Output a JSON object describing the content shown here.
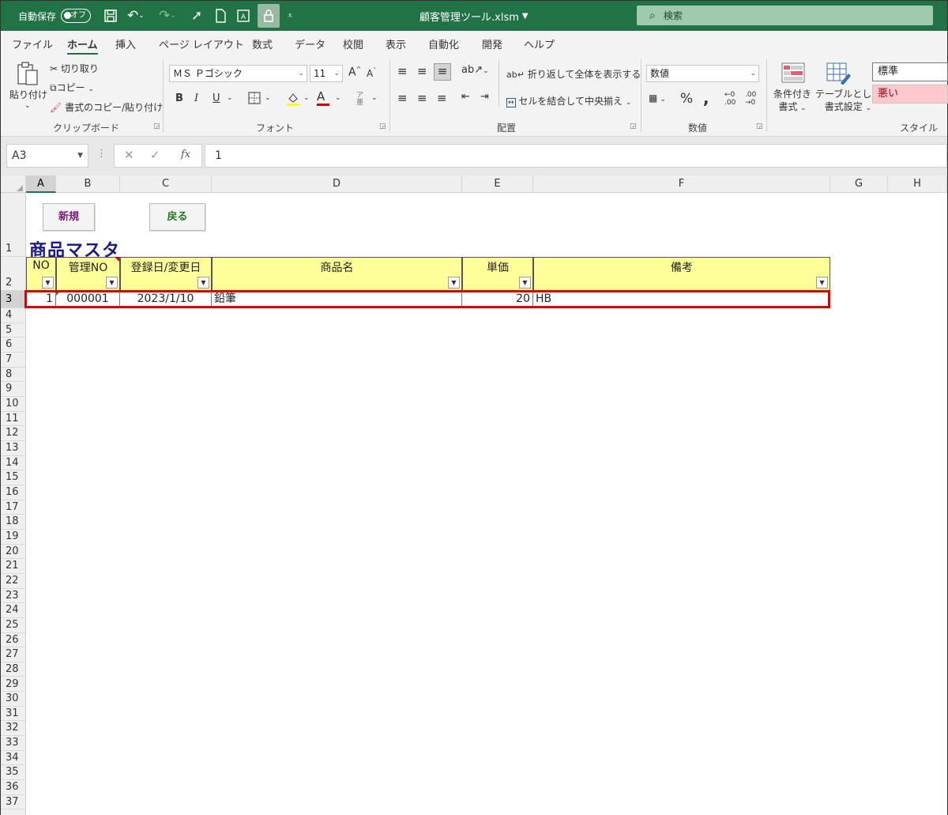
{
  "titlebar": {
    "autosave_label": "自動保存",
    "autosave_state": "オフ",
    "filename": "顧客管理ツール.xlsm",
    "search_placeholder": "検索"
  },
  "menu": {
    "tabs": [
      "ファイル",
      "ホーム",
      "挿入",
      "ページ レイアウト",
      "数式",
      "データ",
      "校閲",
      "表示",
      "自動化",
      "開発",
      "ヘルプ"
    ],
    "active_tab": "ホーム"
  },
  "ribbon": {
    "clipboard": {
      "paste": "貼り付け",
      "cut": "切り取り",
      "copy": "コピー",
      "format_painter": "書式のコピー/貼り付け",
      "group_label": "クリップボード"
    },
    "font": {
      "font_name": "ＭＳ Ｐゴシック",
      "font_size": "11",
      "bold": "B",
      "italic": "I",
      "underline": "U",
      "font_color_glyph": "A",
      "group_label": "フォント"
    },
    "alignment": {
      "wrap_text": "折り返して全体を表示する",
      "merge_center": "セルを結合して中央揃え",
      "group_label": "配置"
    },
    "number": {
      "format": "数値",
      "percent": "%",
      "comma": ",",
      "group_label": "数値"
    },
    "styles": {
      "conditional": "条件付き\n書式",
      "conditional_line1": "条件付き",
      "conditional_line2": "書式",
      "table_line1": "テーブルとして",
      "table_line2": "書式設定",
      "style_normal": "標準",
      "style_bad": "悪い",
      "group_label": "スタイル"
    }
  },
  "formula_bar": {
    "name_box": "A3",
    "formula": "1"
  },
  "columns": [
    "A",
    "B",
    "C",
    "D",
    "E",
    "F",
    "G",
    "H"
  ],
  "rows": [
    "1",
    "2",
    "3",
    "4",
    "5",
    "6",
    "7",
    "8",
    "9",
    "10",
    "11",
    "12",
    "13",
    "14",
    "15",
    "16",
    "17",
    "18",
    "19",
    "20",
    "21",
    "22",
    "23",
    "24",
    "25",
    "26",
    "27",
    "28",
    "29",
    "30",
    "31",
    "32",
    "33",
    "34",
    "35",
    "36",
    "37"
  ],
  "sheet": {
    "new_button": "新規",
    "back_button": "戻る",
    "title": "商品マスタ",
    "headers": [
      "NO",
      "管理NO",
      "登録日/変更日",
      "商品名",
      "単価",
      "備考"
    ],
    "record": {
      "no": "1",
      "mgmt_no": "000001",
      "date": "2023/1/10",
      "product": "鉛筆",
      "price": "20",
      "note": "HB"
    }
  },
  "colors": {
    "excel_green": "#217346",
    "header_fill": "#ffff99",
    "title_blue": "#1a1a8c",
    "highlight_red": "#e00000",
    "new_button_text": "#7a1a7a",
    "back_button_text": "#1a7a1a"
  }
}
